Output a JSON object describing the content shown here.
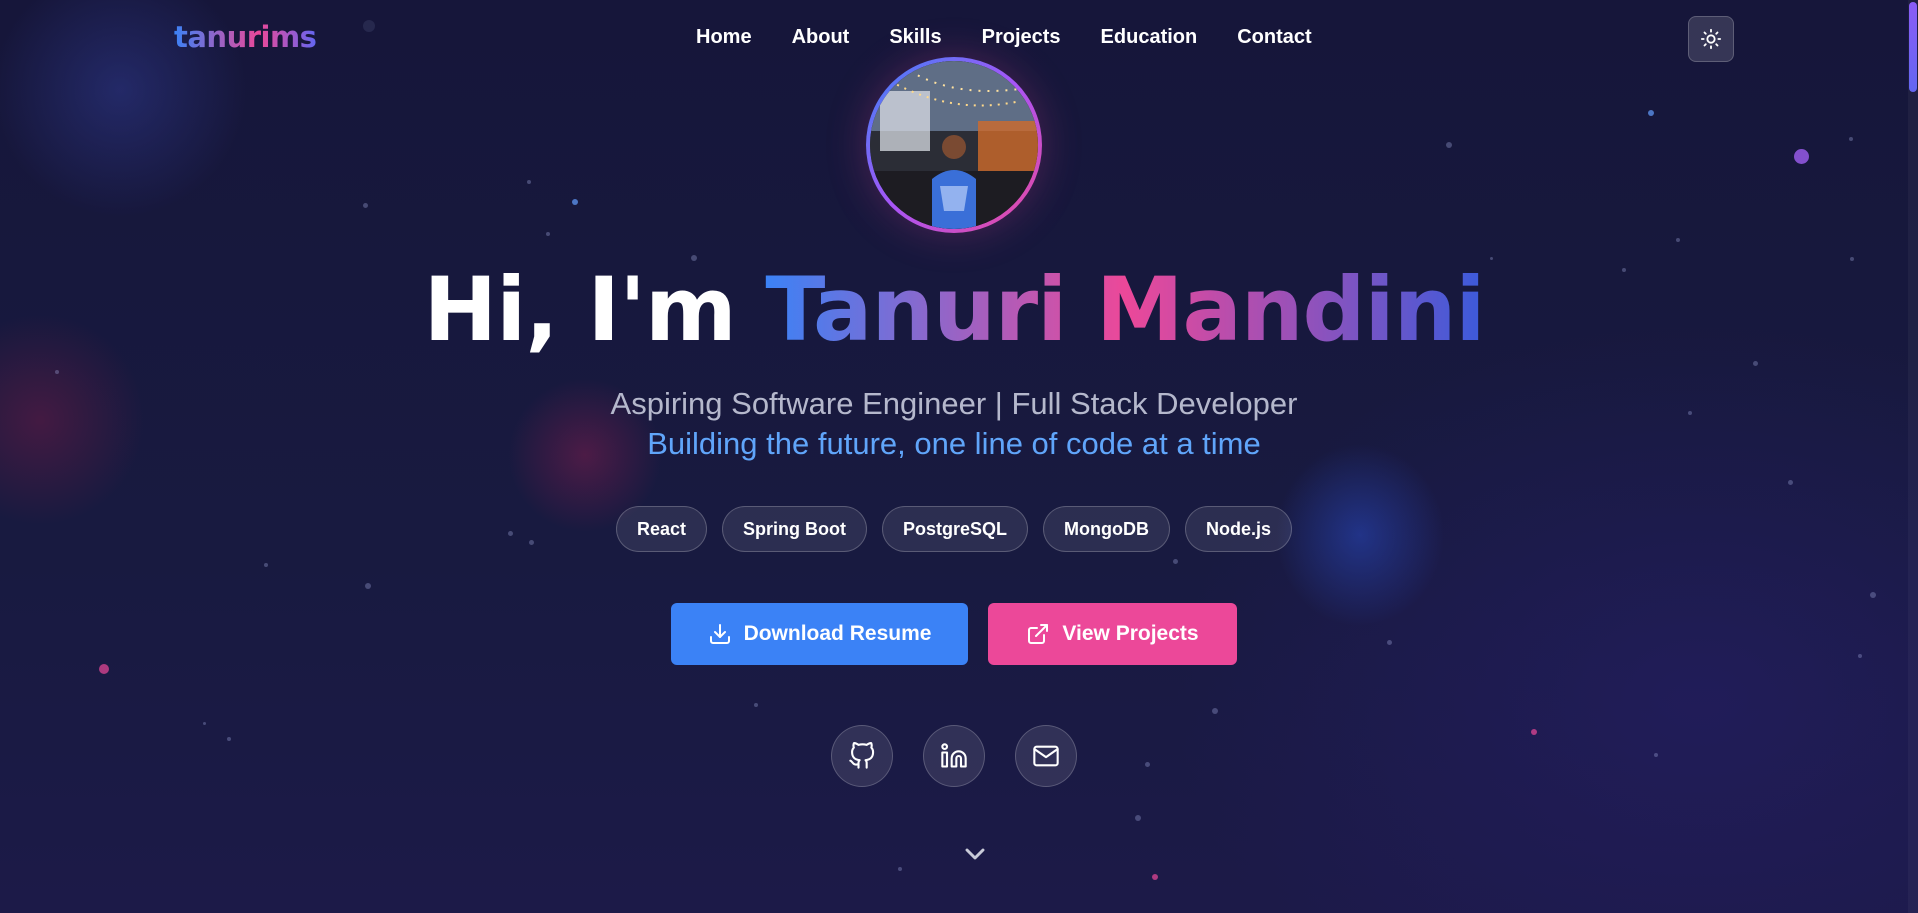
{
  "brand": {
    "logo_text": "tanurims"
  },
  "nav": {
    "items": [
      {
        "label": "Home"
      },
      {
        "label": "About"
      },
      {
        "label": "Skills"
      },
      {
        "label": "Projects"
      },
      {
        "label": "Education"
      },
      {
        "label": "Contact"
      }
    ],
    "theme_toggle_icon": "sun-icon"
  },
  "hero": {
    "greeting": "Hi, I'm",
    "name": "Tanuri Mandini",
    "subtitle": "Aspiring Software Engineer | Full Stack Developer",
    "tagline": "Building the future, one line of code at a time",
    "tags": [
      "React",
      "Spring Boot",
      "PostgreSQL",
      "MongoDB",
      "Node.js"
    ],
    "buttons": {
      "download_resume": "Download Resume",
      "view_projects": "View Projects"
    },
    "socials": [
      {
        "icon": "github-icon"
      },
      {
        "icon": "linkedin-icon"
      },
      {
        "icon": "mail-icon"
      }
    ],
    "scroll_icon": "chevron-down-icon"
  },
  "colors": {
    "background": "#17163a",
    "accent_blue": "#3b82f6",
    "accent_pink": "#ec4899",
    "tagline_blue": "#60a5fa"
  }
}
